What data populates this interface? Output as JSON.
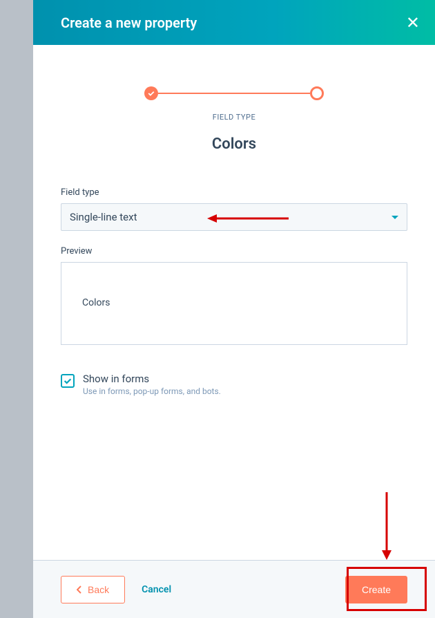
{
  "header": {
    "title": "Create a new property"
  },
  "stepper": {
    "step_label": "FIELD TYPE",
    "property_name": "Colors"
  },
  "form": {
    "field_type_label": "Field type",
    "field_type_value": "Single-line text",
    "preview_label": "Preview",
    "preview_value": "Colors",
    "show_in_forms_label": "Show in forms",
    "show_in_forms_sub": "Use in forms, pop-up forms, and bots.",
    "show_in_forms_checked": true
  },
  "footer": {
    "back_label": "Back",
    "cancel_label": "Cancel",
    "create_label": "Create"
  }
}
